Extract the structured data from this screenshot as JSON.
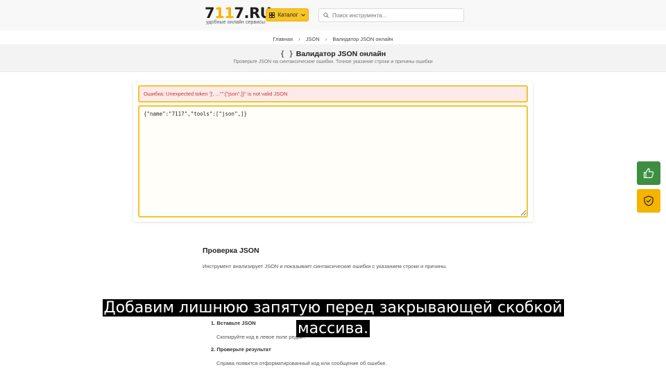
{
  "header": {
    "logo_prefix": "7",
    "logo_highlight": "11",
    "logo_suffix": "7.RU",
    "logo_tagline": "удобные онлайн сервисы",
    "catalog_label": "Каталог",
    "search_placeholder": "Поиск инструмента..."
  },
  "breadcrumb": {
    "items": [
      "Главная",
      "JSON",
      "Валидатор JSON онлайн"
    ]
  },
  "hero": {
    "icon": "{ }",
    "title": "Валидатор JSON онлайн",
    "subtitle": "Проверьте JSON на синтаксические ошибки. Точное указание строки и причины ошибки"
  },
  "validator": {
    "error_message": "Ошибка: Unexpected token ']', ...\"\":[\"json\",]}\" is not valid JSON",
    "input_value": "{\"name\":\"7117\",\"tools\":[\"json\",]}"
  },
  "info": {
    "title": "Проверка JSON",
    "description": "Инструмент анализирует JSON и показывает синтаксические ошибки с указанием строки и причины.",
    "steps": [
      {
        "num": "1.",
        "title": "Вставьте JSON",
        "desc": "Скопируйте код в левое поле редакт"
      },
      {
        "num": "2.",
        "title": "Проверьте результат",
        "desc": "Справа появится отформатированный код или сообщение об ошибке."
      }
    ]
  },
  "side_buttons": {
    "like_icon": "thumbs-up-icon",
    "shield_icon": "shield-check-icon"
  },
  "caption": {
    "line1": "Добавим лишнюю запятую перед закрывающей скобкой",
    "line2": "массива."
  },
  "colors": {
    "accent": "#f5b400",
    "green": "#3e8e41",
    "error": "#c0392b"
  }
}
